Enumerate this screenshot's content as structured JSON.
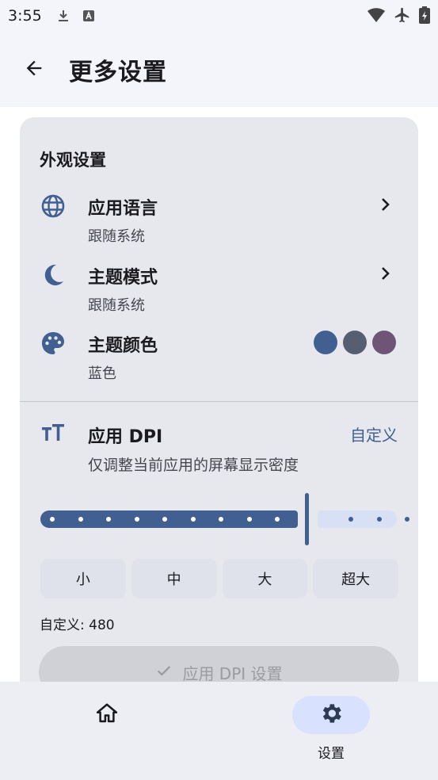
{
  "status_bar": {
    "time": "3:55",
    "left_icons": [
      "download-icon",
      "text-a-icon"
    ],
    "right_icons": [
      "wifi-icon",
      "airplane-icon",
      "battery-icon"
    ]
  },
  "top_bar": {
    "back_icon": "arrow-back-icon",
    "title": "更多设置"
  },
  "appearance": {
    "section_title": "外观设置",
    "language": {
      "icon": "globe-icon",
      "title": "应用语言",
      "value": "跟随系统"
    },
    "theme_mode": {
      "icon": "moon-icon",
      "title": "主题模式",
      "value": "跟随系统"
    },
    "theme_color": {
      "icon": "palette-icon",
      "title": "主题颜色",
      "value": "蓝色",
      "swatches": [
        "#415f91",
        "#565e71",
        "#6f5575"
      ]
    }
  },
  "dpi": {
    "icon": "text-size-icon",
    "title": "应用 DPI",
    "custom_label": "自定义",
    "description": "仅调整当前应用的屏幕显示密度",
    "slider": {
      "fraction": 0.75,
      "steps": 12
    },
    "size_buttons": [
      "小",
      "中",
      "大",
      "超大"
    ],
    "custom_value": "自定义: 480",
    "apply_label": "应用 DPI 设置"
  },
  "bottom_nav": {
    "items": [
      {
        "icon": "home-icon",
        "label": ""
      },
      {
        "icon": "settings-gear-icon",
        "label": "设置"
      }
    ],
    "selected": 1
  },
  "colors": {
    "primary": "#415f91",
    "card_bg": "#e7e8ee",
    "selected_pill": "#d8e2ff"
  }
}
